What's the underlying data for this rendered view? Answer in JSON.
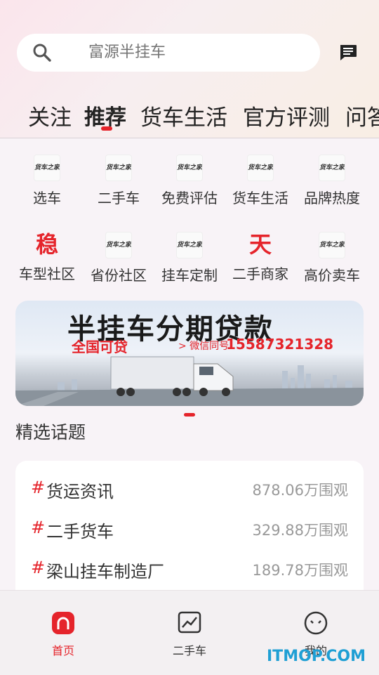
{
  "search": {
    "placeholder": "富源半挂车"
  },
  "tabs": [
    {
      "label": "关注"
    },
    {
      "label": "推荐"
    },
    {
      "label": "货车生活"
    },
    {
      "label": "官方评测"
    },
    {
      "label": "问答"
    }
  ],
  "grid": [
    {
      "label": "选车",
      "icon": "truck-home-logo",
      "icon_text": "货车之家"
    },
    {
      "label": "二手车",
      "icon": "truck-home-logo",
      "icon_text": "货车之家"
    },
    {
      "label": "免费评估",
      "icon": "truck-home-logo",
      "icon_text": "货车之家"
    },
    {
      "label": "货车生活",
      "icon": "truck-home-logo",
      "icon_text": "货车之家"
    },
    {
      "label": "品牌热度",
      "icon": "truck-home-logo",
      "icon_text": "货车之家"
    },
    {
      "label": "车型社区",
      "icon": "stable-char-icon",
      "icon_text": "稳"
    },
    {
      "label": "省份社区",
      "icon": "truck-home-logo",
      "icon_text": "货车之家"
    },
    {
      "label": "挂车定制",
      "icon": "truck-home-logo",
      "icon_text": "货车之家"
    },
    {
      "label": "二手商家",
      "icon": "sky-char-icon",
      "icon_text": "天"
    },
    {
      "label": "高价卖车",
      "icon": "truck-home-logo",
      "icon_text": "货车之家"
    }
  ],
  "banner": {
    "title": "半挂车分期贷款",
    "subtitle": "全国可贷",
    "wechat": "> 微信同号",
    "phone": "15587321328"
  },
  "section_title": "精选话题",
  "topics": [
    {
      "hash": "#",
      "name": "货运资讯",
      "views": "878.06万围观"
    },
    {
      "hash": "#",
      "name": "二手货车",
      "views": "329.88万围观"
    },
    {
      "hash": "#",
      "name": "梁山挂车制造厂",
      "views": "189.78万围观"
    }
  ],
  "bottom_nav": [
    {
      "label": "首页",
      "icon": "home-icon"
    },
    {
      "label": "二手车",
      "icon": "chart-icon"
    },
    {
      "label": "我的",
      "icon": "face-icon"
    }
  ],
  "watermark": "ITMOP.COM",
  "colors": {
    "accent": "#e5242b",
    "text": "#333333",
    "muted": "#999999",
    "watermark": "#1f9fd4"
  }
}
